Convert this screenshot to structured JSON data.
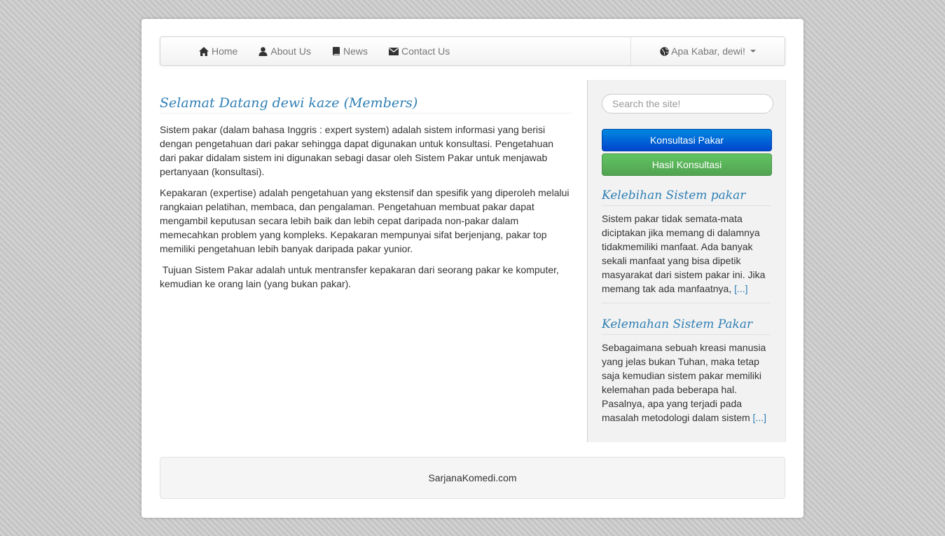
{
  "nav": {
    "items": [
      {
        "label": "Home",
        "icon": "home-icon"
      },
      {
        "label": "About Us",
        "icon": "user-icon"
      },
      {
        "label": "News",
        "icon": "book-icon"
      },
      {
        "label": "Contact Us",
        "icon": "envelope-icon"
      }
    ],
    "user_menu": {
      "label": "Apa Kabar, dewi!",
      "icon": "globe-icon"
    }
  },
  "main": {
    "title": "Selamat Datang dewi kaze (Members)",
    "paragraphs": [
      "Sistem pakar (dalam bahasa Inggris : expert system) adalah sistem informasi yang berisi dengan pengetahuan dari pakar sehingga dapat digunakan untuk konsultasi. Pengetahuan dari pakar didalam sistem ini digunakan sebagi dasar oleh Sistem Pakar untuk menjawab pertanyaan (konsultasi).",
      "Kepakaran (expertise) adalah pengetahuan yang ekstensif dan spesifik yang diperoleh melalui rangkaian pelatihan, membaca, dan pengalaman. Pengetahuan membuat pakar dapat mengambil keputusan secara lebih baik dan lebih cepat daripada non-pakar dalam memecahkan problem yang kompleks. Kepakaran mempunyai sifat berjenjang, pakar top memiliki pengetahuan lebih banyak daripada pakar yunior.",
      " Tujuan Sistem Pakar adalah untuk mentransfer kepakaran dari seorang pakar ke komputer, kemudian ke orang lain (yang bukan pakar)."
    ]
  },
  "sidebar": {
    "search_placeholder": "Search the site!",
    "btn_konsultasi": "Konsultasi Pakar",
    "btn_hasil": "Hasil Konsultasi",
    "blocks": [
      {
        "title": "Kelebihan Sistem pakar",
        "text": "Sistem pakar tidak semata-mata diciptakan jika memang di dalamnya tidakmemiliki manfaat. Ada banyak sekali manfaat yang bisa dipetik masyarakat dari sistem pakar ini. Jika memang tak ada manfaatnya, ",
        "more": "[...]"
      },
      {
        "title": "Kelemahan Sistem Pakar",
        "text": "Sebagaimana sebuah kreasi manusia yang jelas bukan Tuhan, maka tetap saja kemudian sistem pakar memiliki kelemahan pada beberapa hal. Pasalnya, apa yang terjadi pada masalah metodologi dalam sistem ",
        "more": "[...]"
      }
    ]
  },
  "footer": {
    "text": "SarjanaKomedi.com"
  },
  "colors": {
    "accent": "#2f7fb4",
    "primary": "#0055d4",
    "success": "#5bb75b"
  }
}
